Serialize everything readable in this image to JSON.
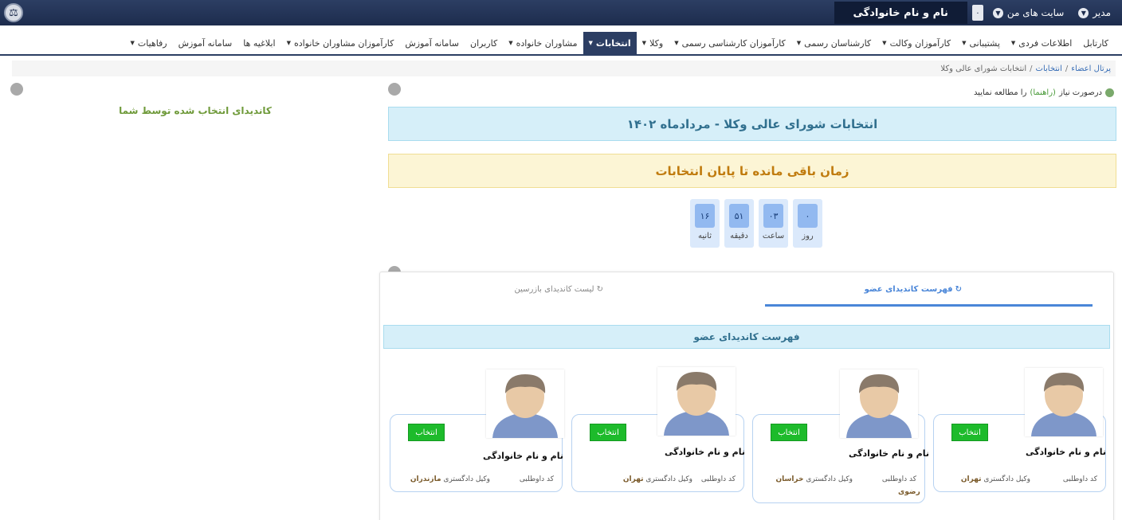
{
  "topbar": {
    "user_name": "نام و نام خانوادگی",
    "notif_count": "۰",
    "my_sites": "سایت های من",
    "role": "مدیر",
    "logo_icon": "scales-icon"
  },
  "nav": {
    "items": [
      {
        "label": "کارتابل"
      },
      {
        "label": "اطلاعات فردی"
      },
      {
        "label": "پشتیبانی"
      },
      {
        "label": "کارآموزان وکالت"
      },
      {
        "label": "کارشناسان رسمی"
      },
      {
        "label": "کارآموزان کارشناسی رسمی"
      },
      {
        "label": "وکلا"
      },
      {
        "label": "انتخابات"
      },
      {
        "label": "مشاوران خانواده"
      },
      {
        "label": "کاربران"
      },
      {
        "label": "سامانه آموزش"
      },
      {
        "label": "کارآموزان مشاوران خانواده"
      },
      {
        "label": "ابلاغیه ها"
      },
      {
        "label": "سامانه آموزش"
      },
      {
        "label": "رفاهیات"
      }
    ],
    "active": "انتخابات"
  },
  "breadcrumb": {
    "portal": "پرتال اعضاء",
    "section": "انتخابات",
    "current": "انتخابات شورای عالی وکلا"
  },
  "left_panel": {
    "title": "کاندیدای انتخاب شده توسط شما"
  },
  "help": {
    "prefix": "درصورت نیاز",
    "link": "(راهنما)",
    "suffix": "را مطالعه نمایید"
  },
  "election": {
    "title": "انتخابات شورای عالی وکلا - مردادماه ۱۴۰۲",
    "countdown_title": "زمان باقی مانده تا پایان انتخابات"
  },
  "timer": {
    "days": {
      "value": "۰",
      "label": "روز"
    },
    "hours": {
      "value": "۰۳",
      "label": "ساعت"
    },
    "minutes": {
      "value": "۵۱",
      "label": "دقیقه"
    },
    "seconds": {
      "value": "۱۶",
      "label": "ثانیه"
    }
  },
  "tabs": {
    "members": "فهرست کاندیدای عضو",
    "inspectors": "لیست کاندیدای بازرسین"
  },
  "list_header": "فهرست کاندیدای عضو",
  "candidates": [
    {
      "name": "نام و نام خانوادگی",
      "button": "انتخاب",
      "code_label": "کد داوطلبی",
      "court_label": "وکیل دادگستری",
      "city": "تهران",
      "city_extra": ""
    },
    {
      "name": "نام و نام خانوادگی",
      "button": "انتخاب",
      "code_label": "کد داوطلبی",
      "court_label": "وکیل دادگستری",
      "city": "خراسان",
      "city_extra": "رضوی"
    },
    {
      "name": "نام و نام خانوادگی",
      "button": "انتخاب",
      "code_label": "کد داوطلبی",
      "court_label": "وکیل دادگستری",
      "city": "تهران",
      "city_extra": ""
    },
    {
      "name": "نام و نام خانوادگی",
      "button": "انتخاب",
      "code_label": "کد داوطلبی",
      "court_label": "وکیل دادگستری",
      "city": "مازندران",
      "city_extra": ""
    }
  ],
  "colors": {
    "header_bg": "#1d2c4d",
    "info_bg": "#d6eff9",
    "warning_bg": "#fcf5d5",
    "select_button": "#1dbb2b",
    "tab_active": "#4a86d8"
  }
}
